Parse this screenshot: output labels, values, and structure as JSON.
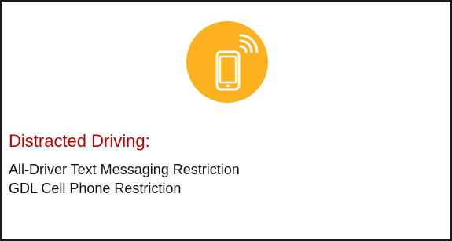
{
  "colors": {
    "accent": "#FBB21E",
    "title": "#C00000",
    "icon_stroke": "#FFFFFF"
  },
  "icon": {
    "name": "mobile-phone-signal-icon"
  },
  "card": {
    "title": "Distracted Driving:",
    "items": [
      "All-Driver Text Messaging Restriction",
      "GDL Cell Phone Restriction"
    ]
  }
}
